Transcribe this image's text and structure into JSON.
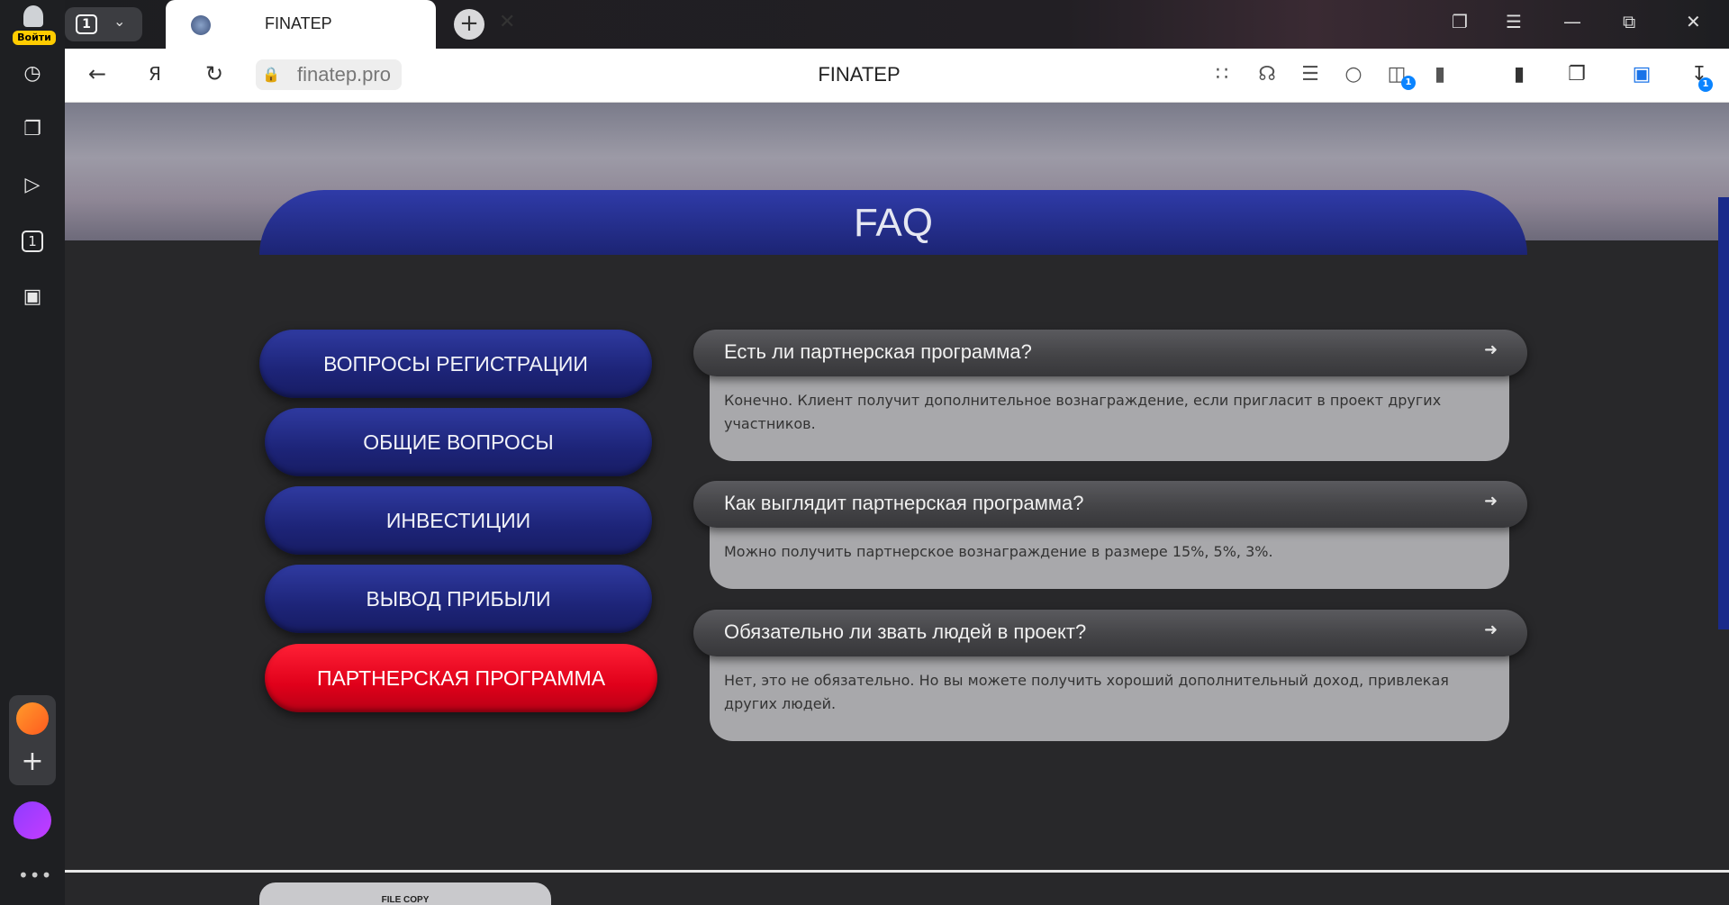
{
  "browser": {
    "login_label": "Войти",
    "tab_count": "1",
    "tab_title": "FINATEP",
    "url": "finatep.pro",
    "page_title": "FINATEP",
    "download_badge": "1",
    "shield_badge": "1",
    "sidebar_tabs_count": "1"
  },
  "page": {
    "faq_title": "FAQ",
    "categories": [
      {
        "label": "ВОПРОСЫ РЕГИСТРАЦИИ",
        "active": false
      },
      {
        "label": "ОБЩИЕ ВОПРОСЫ",
        "active": false
      },
      {
        "label": "ИНВЕСТИЦИИ",
        "active": false
      },
      {
        "label": "ВЫВОД ПРИБЫЛИ",
        "active": false
      },
      {
        "label": "ПАРТНЕРСКАЯ ПРОГРАММА",
        "active": true
      }
    ],
    "faqs": [
      {
        "question": "Есть ли партнерская программа?",
        "answer": "Конечно. Клиент получит дополнительное вознаграждение, если пригласит в проект других участников."
      },
      {
        "question": "Как выглядит партнерская программа?",
        "answer": "Можно получить партнерское вознаграждение в размере 15%, 5%, 3%."
      },
      {
        "question": "Обязательно ли звать людей в проект?",
        "answer": "Нет, это не обязательно. Но вы можете получить хороший дополнительный доход, привлекая других людей."
      }
    ],
    "footer_tab": "FILE COPY"
  },
  "colors": {
    "category_blue": "#1d2478",
    "category_active_red": "#e0001a",
    "page_bg": "#28282a"
  }
}
